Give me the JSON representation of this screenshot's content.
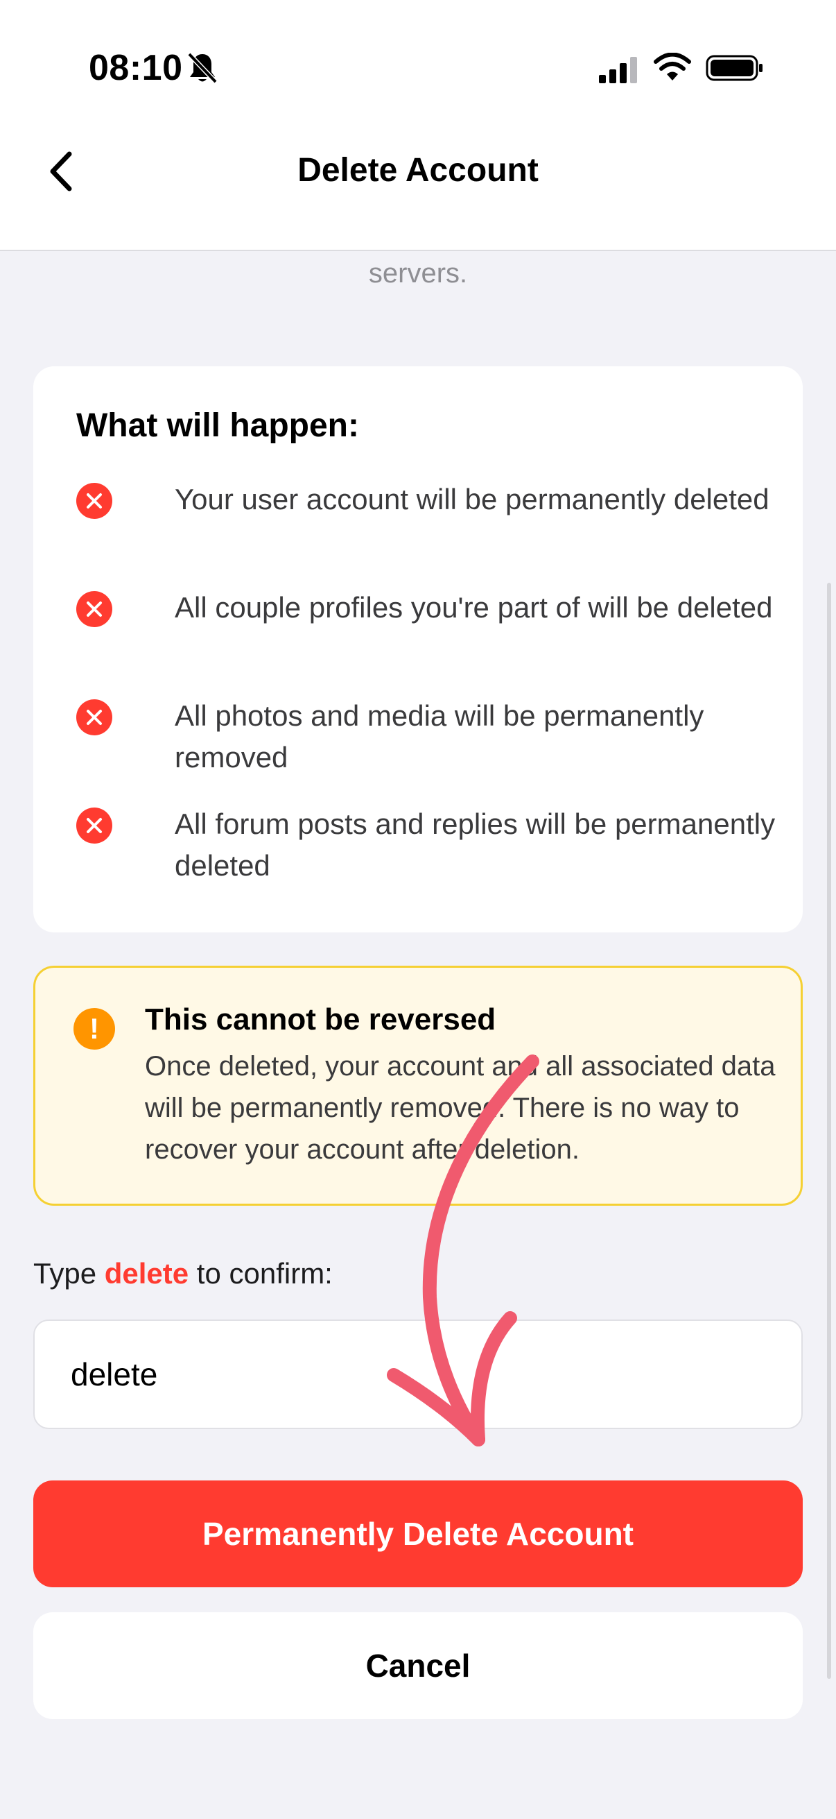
{
  "status_bar": {
    "time": "08:10",
    "icons": [
      "bell-slash-icon",
      "signal-icon",
      "wifi-icon",
      "battery-icon"
    ]
  },
  "nav": {
    "title": "Delete Account",
    "back_icon": "chevron-left-icon"
  },
  "faded_text": "servers.",
  "consequences": {
    "heading": "What will happen:",
    "items": [
      "Your user account will be permanently deleted",
      "All couple profiles you're part of will be deleted",
      "All photos and media will be permanently removed",
      "All forum posts and replies will be permanently deleted"
    ],
    "icon": "x-circle-icon"
  },
  "warning": {
    "icon": "exclamation-circle-icon",
    "title": "This cannot be reversed",
    "body": "Once deleted, your account and all associated data will be permanently removed. There is no way to recover your account after deletion."
  },
  "confirm": {
    "label_before": "Type ",
    "keyword": "delete",
    "label_after": " to confirm:",
    "input_value": "delete"
  },
  "buttons": {
    "delete_label": "Permanently Delete Account",
    "cancel_label": "Cancel"
  },
  "colors": {
    "danger": "#ff3b30",
    "warning_bg": "#fff9e6",
    "warning_border": "#f5d033",
    "warning_icon": "#ff9500",
    "annotation_arrow": "#f05a6e",
    "background": "#f2f2f7"
  }
}
